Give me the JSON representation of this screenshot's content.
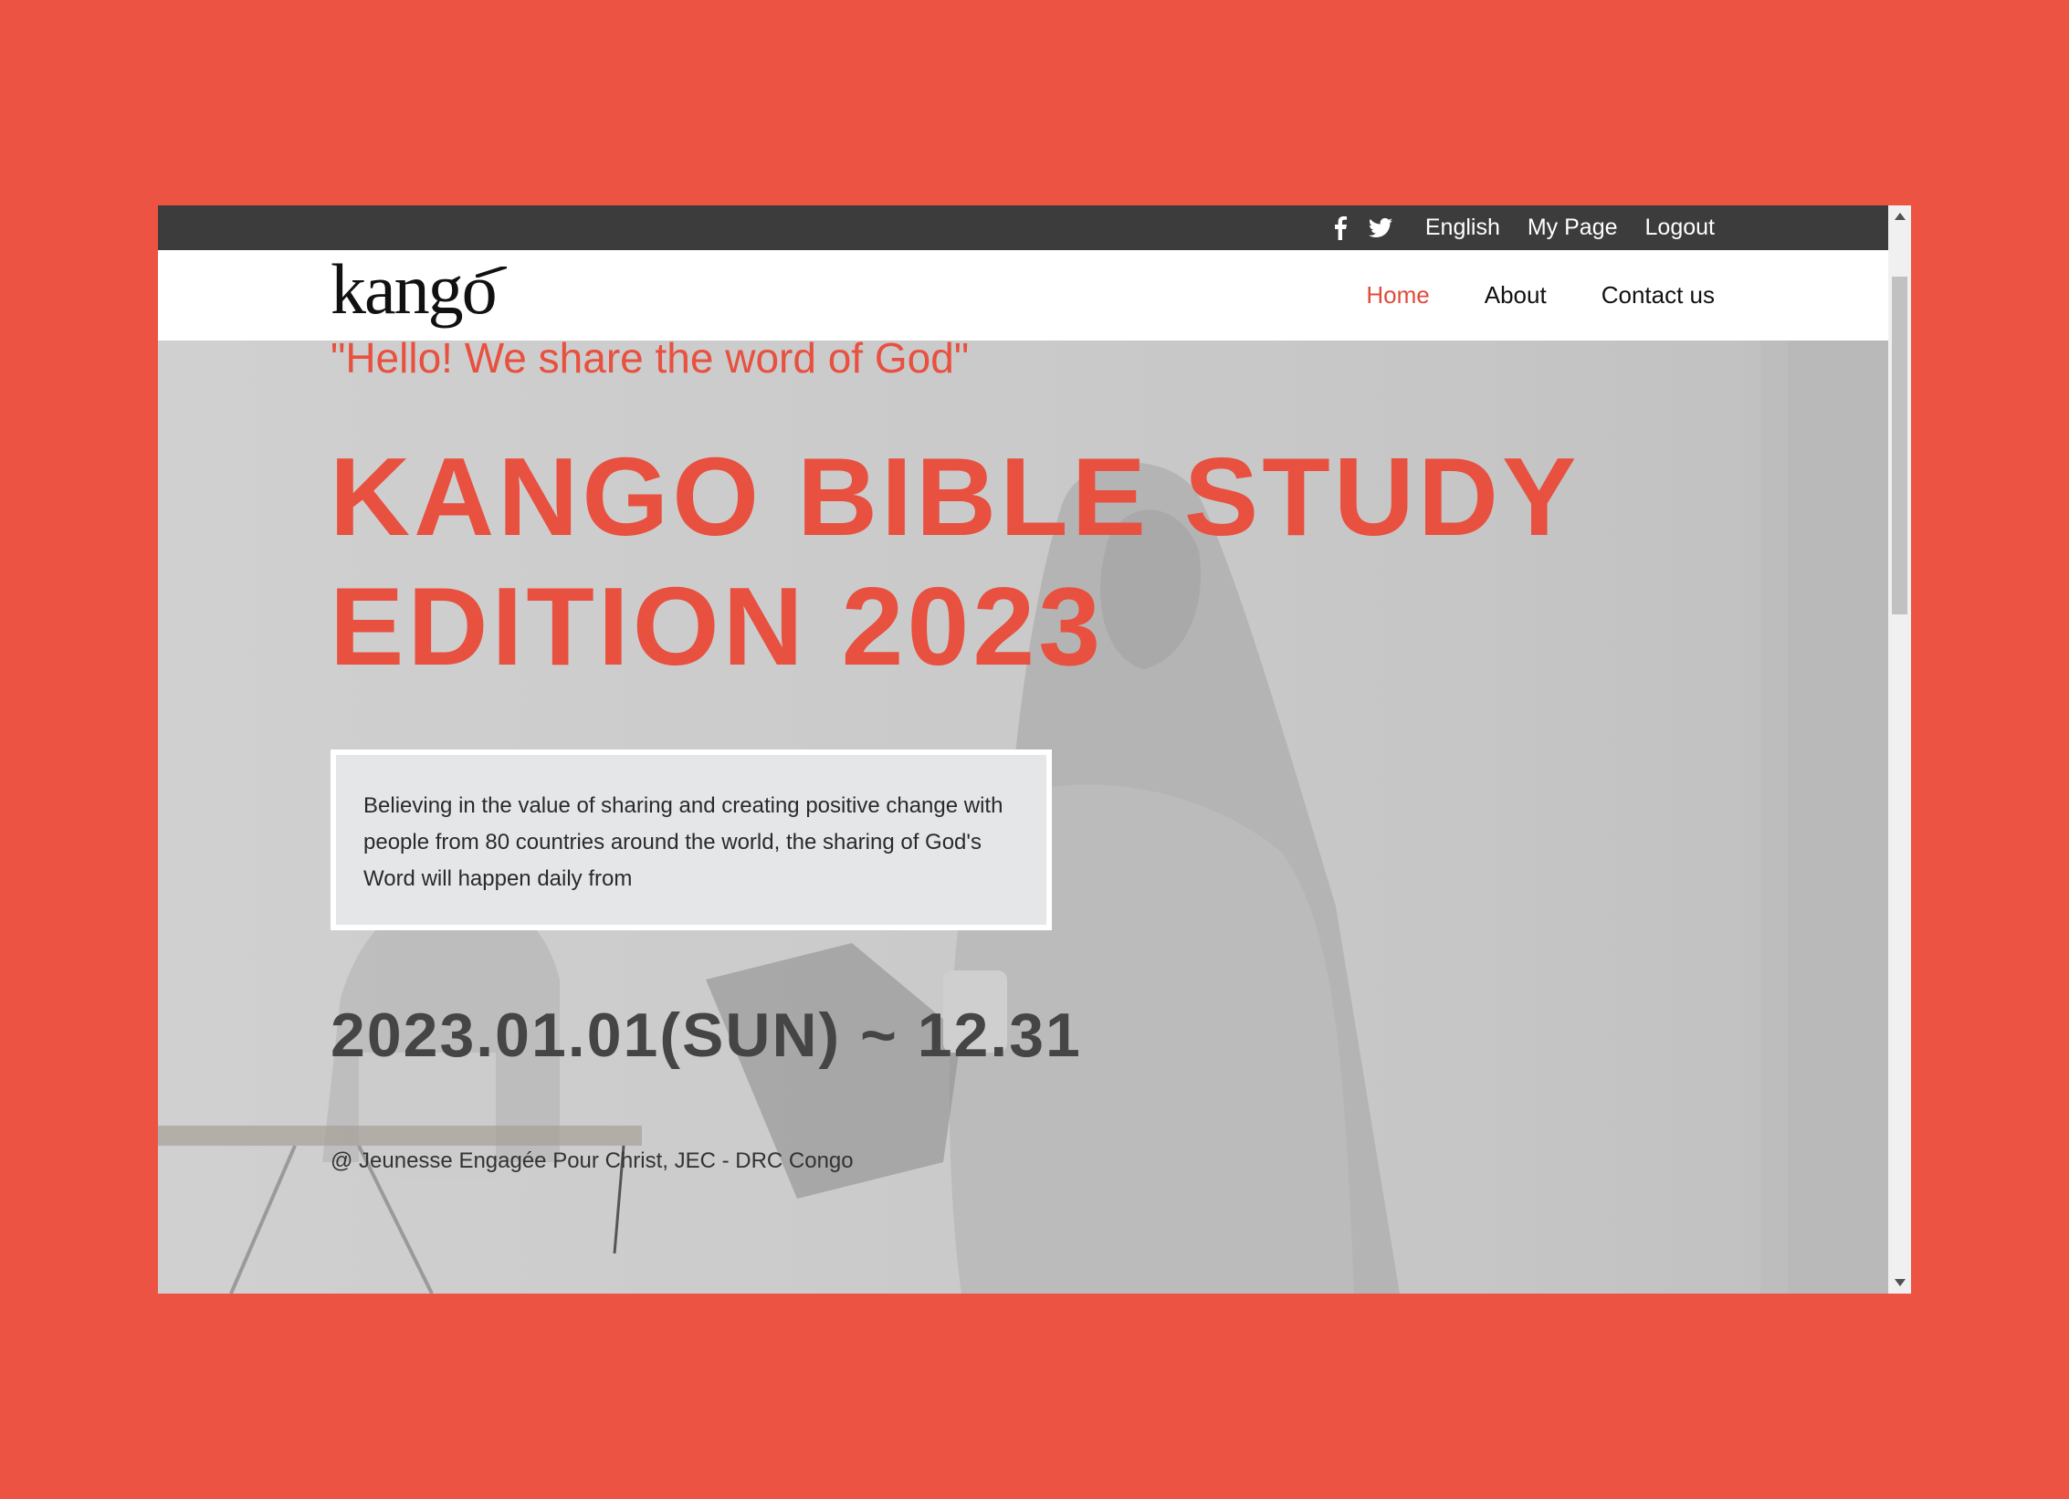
{
  "colors": {
    "accent": "#e8503f",
    "background": "#ec5343",
    "topbar": "#3c3c3c"
  },
  "topbar": {
    "social": [
      {
        "icon": "facebook-icon"
      },
      {
        "icon": "twitter-icon"
      }
    ],
    "language": "English",
    "mypage": "My Page",
    "logout": "Logout"
  },
  "navbar": {
    "logo": "kango",
    "menu": [
      "Home",
      "About",
      "Contact us"
    ],
    "active": "Home"
  },
  "hero": {
    "tagline": "\"Hello! We share the word of God\"",
    "headline_line1": "KANGO BIBLE STUDY",
    "headline_line2": "EDITION 2023",
    "description": "Believing in the value of sharing and creating positive change with people from 80 countries around the world, the sharing of God's Word will happen daily from",
    "daterange": "2023.01.01(SUN) ~ 12.31",
    "location": "@ Jeunesse Engagée Pour Christ, JEC - DRC Congo"
  }
}
